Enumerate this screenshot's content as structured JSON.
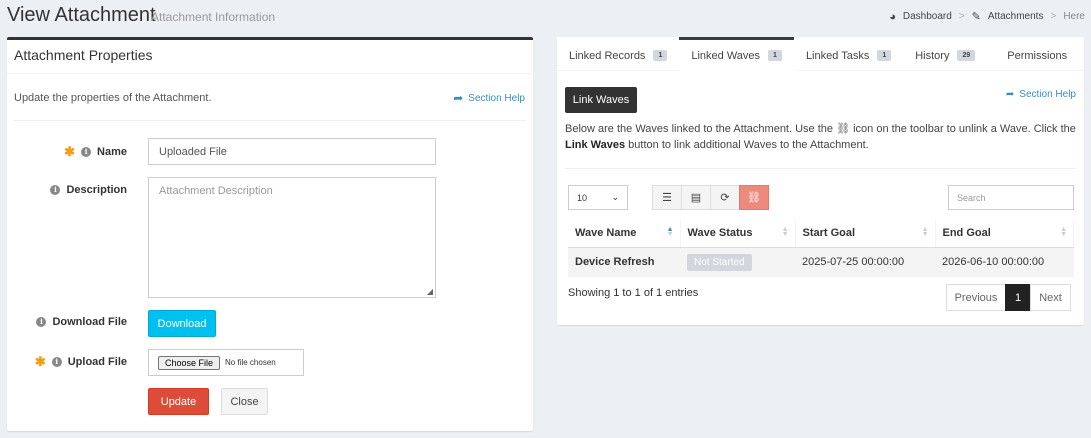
{
  "header": {
    "title": "View Attachment",
    "subtitle": "Attachment Information",
    "breadcrumb": [
      "Dashboard",
      "Attachments",
      "Here"
    ]
  },
  "properties": {
    "title": "Attachment Properties",
    "help_text": "Update the properties of the Attachment.",
    "section_help": "Section Help",
    "name_label": "Name",
    "name_value": "Uploaded File",
    "description_label": "Description",
    "description_placeholder": "Attachment Description",
    "download_label": "Download File",
    "download_button": "Download",
    "upload_label": "Upload File",
    "choose_file": "Choose File",
    "no_file": "No file chosen",
    "update_button": "Update",
    "close_button": "Close"
  },
  "tabs": [
    {
      "label": "Linked Records",
      "count": "1"
    },
    {
      "label": "Linked Waves",
      "count": "1"
    },
    {
      "label": "Linked Tasks",
      "count": "1"
    },
    {
      "label": "History",
      "count": "29"
    },
    {
      "label": "Permissions",
      "count": ""
    }
  ],
  "waves": {
    "link_button": "Link Waves",
    "section_help": "Section Help",
    "desc_part1": "Below are the Waves linked to the Attachment. Use the ",
    "desc_part2": " icon on the toolbar to unlink a Wave. Click the ",
    "desc_bold": "Link Waves",
    "desc_part3": " button to link additional Waves to the Attachment.",
    "page_length": "10",
    "search_placeholder": "Search",
    "columns": [
      "Wave Name",
      "Wave Status",
      "Start Goal",
      "End Goal"
    ],
    "rows": [
      {
        "name": "Device Refresh",
        "status": "Not Started",
        "start": "2025-07-25 00:00:00",
        "end": "2026-06-10 00:00:00"
      }
    ],
    "entries_info": "Showing 1 to 1 of 1 entries",
    "pager": {
      "previous": "Previous",
      "current": "1",
      "next": "Next"
    }
  }
}
